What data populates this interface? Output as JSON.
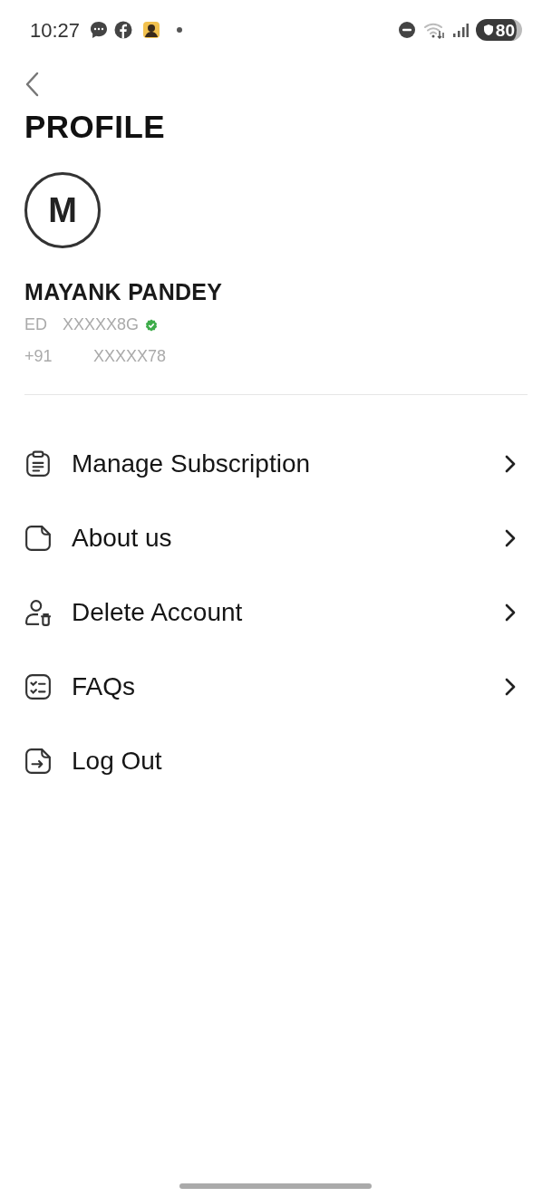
{
  "status_bar": {
    "time": "10:27",
    "battery": "80"
  },
  "header": {
    "title": "PROFILE"
  },
  "profile": {
    "initial": "M",
    "name": "MAYANK PANDEY",
    "id_prefix": "ED",
    "id_value": "XXXXX8G",
    "verified": true,
    "phone_prefix": "+91",
    "phone_value": "XXXXX78"
  },
  "menu": [
    {
      "kind": "clipboard",
      "label": "Manage Subscription",
      "chevron": true
    },
    {
      "kind": "note",
      "label": "About us",
      "chevron": true
    },
    {
      "kind": "user-delete",
      "label": "Delete Account",
      "chevron": true
    },
    {
      "kind": "checklist",
      "label": "FAQs",
      "chevron": true
    },
    {
      "kind": "logout",
      "label": "Log Out",
      "chevron": false
    }
  ]
}
